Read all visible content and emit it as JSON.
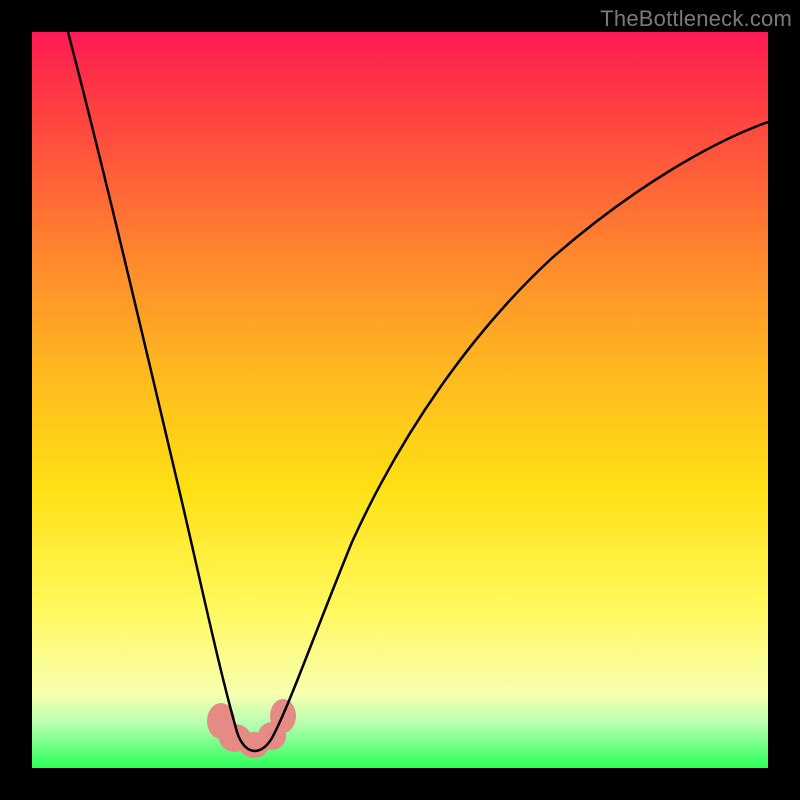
{
  "watermark": {
    "text": "TheBottleneck.com"
  },
  "chart_data": {
    "type": "line",
    "title": "",
    "xlabel": "",
    "ylabel": "",
    "xlim": [
      0,
      100
    ],
    "ylim": [
      0,
      100
    ],
    "series": [
      {
        "name": "bottleneck-curve",
        "x": [
          0,
          5,
          10,
          15,
          18,
          21,
          23,
          25,
          27,
          28,
          29,
          30,
          31,
          33,
          36,
          40,
          46,
          54,
          64,
          76,
          90,
          100
        ],
        "values": [
          100,
          84,
          68,
          52,
          40,
          28,
          18,
          10,
          4,
          1,
          0,
          0,
          3,
          10,
          22,
          36,
          50,
          62,
          72,
          80,
          86,
          88
        ]
      }
    ],
    "annotations": [
      {
        "name": "highlight-region-left",
        "x": 25.0,
        "y": 6.0
      },
      {
        "name": "highlight-region-minimum",
        "x": 29.0,
        "y": 1.5
      },
      {
        "name": "highlight-region-right",
        "x": 32.5,
        "y": 6.5
      }
    ],
    "colors": {
      "curve": "#000000",
      "highlight": "#e58a84",
      "gradient_top": "#ff1a55",
      "gradient_bottom": "#2bff57"
    }
  }
}
